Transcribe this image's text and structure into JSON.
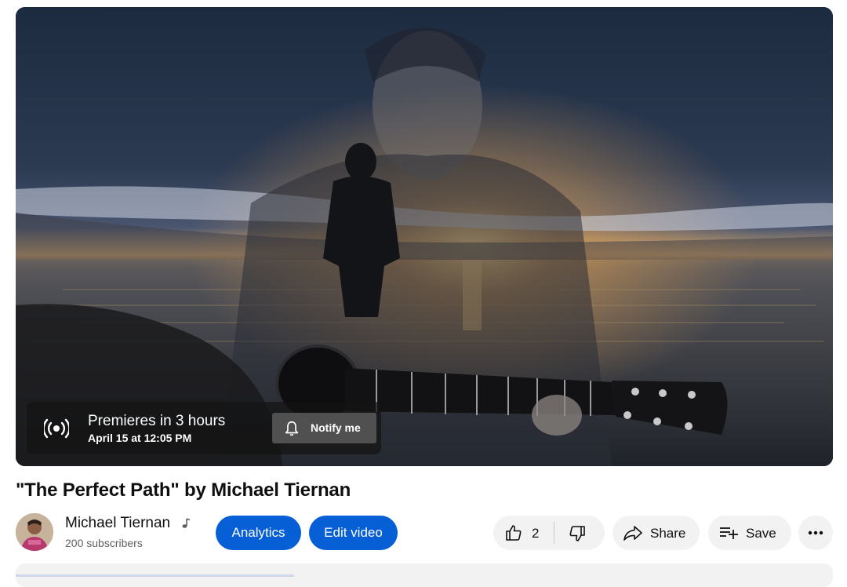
{
  "player": {
    "thumbnail": "sunset-sea-guitarist-double-exposure",
    "premiere": {
      "icon": "live-broadcast-icon",
      "title": "Premieres in 3 hours",
      "date": "April 15 at 12:05 PM",
      "notify_label": "Notify me",
      "notify_icon": "bell-icon"
    }
  },
  "video": {
    "title": "\"The Perfect Path\" by Michael Tiernan"
  },
  "channel": {
    "name": "Michael Tiernan",
    "badge_icon": "music-note-icon",
    "subscribers": "200 subscribers"
  },
  "actions": {
    "analytics_label": "Analytics",
    "edit_label": "Edit video",
    "like_count": "2",
    "share_label": "Share",
    "save_label": "Save"
  },
  "colors": {
    "accent_blue": "#065fd4",
    "chip_grey": "#f2f2f2",
    "secondary_text": "#606060"
  }
}
